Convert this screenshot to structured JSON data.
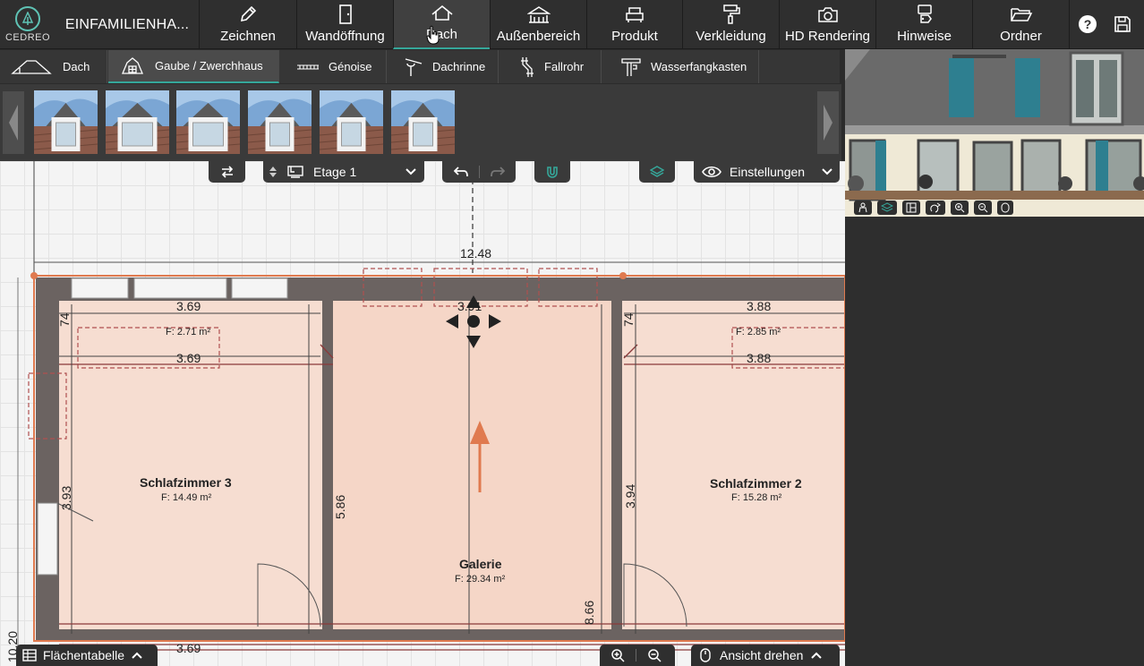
{
  "app": {
    "logo_text": "CEDREO",
    "project_title": "EINFAMILIENHA..."
  },
  "toolbar": {
    "items": [
      {
        "label": "Zeichnen",
        "icon": "pencil-icon"
      },
      {
        "label": "Wandöffnung",
        "icon": "door-icon"
      },
      {
        "label": "Dach",
        "icon": "roof-icon",
        "active": true
      },
      {
        "label": "Außenbereich",
        "icon": "terrace-icon"
      },
      {
        "label": "Produkt",
        "icon": "armchair-icon"
      },
      {
        "label": "Verkleidung",
        "icon": "paint-roller-icon"
      },
      {
        "label": "HD Rendering",
        "icon": "camera-icon"
      },
      {
        "label": "Hinweise",
        "icon": "tags-icon"
      },
      {
        "label": "Ordner",
        "icon": "folder-icon"
      }
    ],
    "help_label": "?"
  },
  "subtoolbar": {
    "items": [
      {
        "label": "Dach",
        "icon": "roof-outline-icon"
      },
      {
        "label": "Gaube / Zwerchhaus",
        "icon": "dormer-icon",
        "active": true
      },
      {
        "label": "Génoise",
        "icon": "genoise-icon"
      },
      {
        "label": "Dachrinne",
        "icon": "gutter-icon"
      },
      {
        "label": "Fallrohr",
        "icon": "downpipe-icon"
      },
      {
        "label": "Wasserfangkasten",
        "icon": "rainwater-head-icon"
      }
    ]
  },
  "thumbnails": [
    {
      "name": "dormer-thumbnail-1"
    },
    {
      "name": "dormer-thumbnail-2"
    },
    {
      "name": "dormer-thumbnail-3"
    },
    {
      "name": "dormer-thumbnail-4"
    },
    {
      "name": "dormer-thumbnail-5"
    },
    {
      "name": "dormer-thumbnail-6"
    }
  ],
  "canvas_toolbar": {
    "floor_label": "Etage 1",
    "settings_label": "Einstellungen"
  },
  "plan": {
    "overall_width": "12.48",
    "rooms": [
      {
        "name": "Schlafzimmer 3",
        "area": "F: 14.49 m²"
      },
      {
        "name": "Galerie",
        "area": "F: 29.34 m²"
      },
      {
        "name": "Schlafzimmer 2",
        "area": "F: 15.28 m²"
      }
    ],
    "dims": {
      "left_top": "3.69",
      "left_inner": "3.69",
      "left_bottom": "3.69",
      "mid_top": "3.91",
      "right_top": "3.88",
      "right_inner": "3.88",
      "left_small": "74",
      "right_small": "74",
      "left_height": "3.93",
      "center_wall": "5.86",
      "right_height": "3.94",
      "right_wall": "8.66",
      "left_edge": "10.20"
    },
    "dormer_areas": [
      "F: 2.71 m²",
      "F: 2.85 m²"
    ]
  },
  "bottom": {
    "area_table_label": "Flächentabelle",
    "rotate_view_label": "Ansicht drehen"
  },
  "colors": {
    "accent": "#35a79a",
    "room_fill": "#f6ddd1",
    "wall": "#6b6361",
    "selection": "#e07a4f",
    "arrow": "#e07a4f"
  }
}
